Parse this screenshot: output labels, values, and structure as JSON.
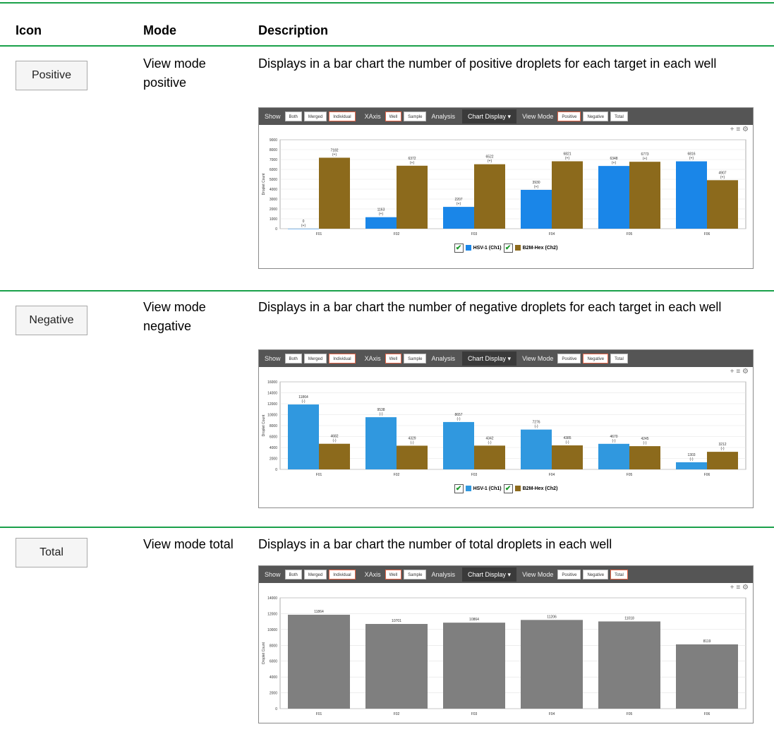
{
  "colors": {
    "rule": "#1aa14a",
    "hsv": "#1a86e8",
    "hsv_neg": "#3098df",
    "b2m": "#8c6a1c",
    "total": "#7f7f7f",
    "selected": "#e8674a"
  },
  "header": {
    "icon": "Icon",
    "mode": "Mode",
    "description": "Description"
  },
  "rows": [
    {
      "icon_label": "Positive",
      "mode": "View mode positive",
      "description": "Displays in a bar chart the number of positive droplets for each target in each well"
    },
    {
      "icon_label": "Negative",
      "mode": "View mode negative",
      "description": "Displays in a bar chart the number of negative droplets for each target in each well"
    },
    {
      "icon_label": "Total",
      "mode": "View mode total",
      "description": "Displays in a bar chart the number of total droplets in each well"
    }
  ],
  "toolbar": {
    "show": "Show",
    "both": "Both",
    "merged": "Merged",
    "individual": "Individual",
    "xaxis": "XAxis",
    "well": "Well",
    "sample": "Sample",
    "analysis": "Analysis",
    "chart_display": "Chart Display",
    "view_mode": "View Mode",
    "positive": "Positive",
    "negative": "Negative",
    "total": "Total",
    "tool_icons": "+ ≡ ⚙"
  },
  "legend": {
    "s1": "HSV-1 (Ch1)",
    "s2": "B2M-Hex (Ch2)"
  },
  "chart_data": [
    {
      "type": "bar",
      "categories": [
        "F01",
        "F02",
        "F03",
        "F04",
        "F05",
        "F06"
      ],
      "ylabel": "Droplet Count",
      "ylim": [
        0,
        9000
      ],
      "yticks": [
        0,
        1000,
        2000,
        3000,
        4000,
        5000,
        6000,
        7000,
        8000,
        9000
      ],
      "series": [
        {
          "name": "HSV-1 (Ch1)",
          "values": [
            0,
            1163,
            2207,
            3930,
            6348,
            6816
          ],
          "labels": [
            "0",
            "1163",
            "2207",
            "3930",
            "6348",
            "6816"
          ]
        },
        {
          "name": "B2M-Hex (Ch2)",
          "values": [
            7182,
            6372,
            6522,
            6821,
            6773,
            4907
          ],
          "labels": [
            "7182",
            "6372",
            "6522",
            "6821",
            "6773",
            "4907"
          ]
        }
      ],
      "sublabel": "(+)"
    },
    {
      "type": "bar",
      "categories": [
        "F01",
        "F02",
        "F03",
        "F04",
        "F05",
        "F06"
      ],
      "ylabel": "Droplet Count",
      "ylim": [
        0,
        16000
      ],
      "yticks": [
        0,
        2000,
        4000,
        6000,
        8000,
        10000,
        12000,
        14000,
        16000
      ],
      "series": [
        {
          "name": "HSV-1 (Ch1)",
          "values": [
            11864,
            9538,
            8657,
            7276,
            4670,
            1303
          ],
          "labels": [
            "11864",
            "9538",
            "8657",
            "7276",
            "4670",
            "1303"
          ]
        },
        {
          "name": "B2M-Hex (Ch2)",
          "values": [
            4682,
            4329,
            4342,
            4385,
            4245,
            3212
          ],
          "labels": [
            "4682",
            "4329",
            "4342",
            "4385",
            "4245",
            "3212"
          ]
        }
      ],
      "sublabel": "(-)"
    },
    {
      "type": "bar",
      "categories": [
        "F01",
        "F02",
        "F03",
        "F04",
        "F05",
        "F06"
      ],
      "ylabel": "Droplet Count",
      "ylim": [
        0,
        14000
      ],
      "yticks": [
        0,
        2000,
        4000,
        6000,
        8000,
        10000,
        12000,
        14000
      ],
      "series": [
        {
          "values": [
            11864,
            10701,
            10864,
            11206,
            11018,
            8119
          ],
          "labels": [
            "11864",
            "10701",
            "10864",
            "11206",
            "11018",
            "8119"
          ]
        }
      ],
      "sublabel": ""
    }
  ]
}
